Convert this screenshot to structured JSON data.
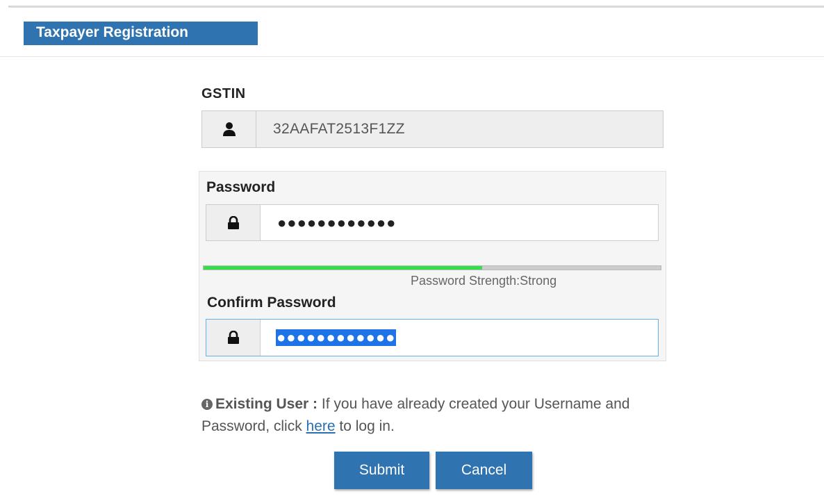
{
  "header": {
    "title": "Taxpayer Registration"
  },
  "gstin": {
    "label": "GSTIN",
    "icon": "user-icon",
    "value": "32AAFAT2513F1ZZ"
  },
  "password": {
    "label": "Password",
    "icon": "lock-icon",
    "masked_value": "●●●●●●●●●●●●"
  },
  "strength": {
    "text": "Password Strength:Strong",
    "level_fraction": 0.61,
    "fill_color": "#33e04a"
  },
  "confirm_password": {
    "label": "Confirm Password",
    "icon": "lock-icon",
    "masked_value": "●●●●●●●●●●●●"
  },
  "existing_user": {
    "icon": "info-circle-icon",
    "heading": "Existing User :",
    "text_before_link": " If you have already created your Username and Password, click ",
    "link_text": "here",
    "text_after_link": " to log in."
  },
  "actions": {
    "submit_label": "Submit",
    "cancel_label": "Cancel"
  },
  "colors": {
    "primary": "#2f73b0",
    "focus_border": "#66afe9",
    "selection": "#1e73e8"
  }
}
